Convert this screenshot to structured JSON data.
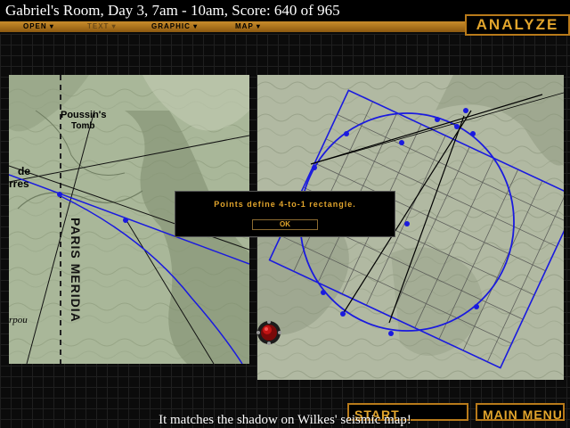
{
  "title": "Gabriel's Room, Day 3, 7am - 10am, Score: 640 of 965",
  "mode_label": "ANALYZE",
  "menu": {
    "open": "OPEN ▾",
    "text": "TEXT ▾",
    "graphic": "GRAPHIC ▾",
    "map": "MAP ▾"
  },
  "left_map": {
    "label_tomb_1": "Poussin's",
    "label_tomb_2": "Tomb",
    "label_de": "de",
    "label_rres": "rres",
    "label_meridian": "PARIS MERIDIA",
    "label_pou": "rpou"
  },
  "dialog": {
    "message": "Points define 4-to-1 rectangle.",
    "ok_label": "OK"
  },
  "buttons": {
    "start_analysis": "START ANALYSIS",
    "main_menu": "MAIN MENU"
  },
  "caption": "It matches the shadow on Wilkes' seismic map!",
  "colors": {
    "accent": "#e2a52c",
    "overlay_line": "#1a1adf"
  }
}
